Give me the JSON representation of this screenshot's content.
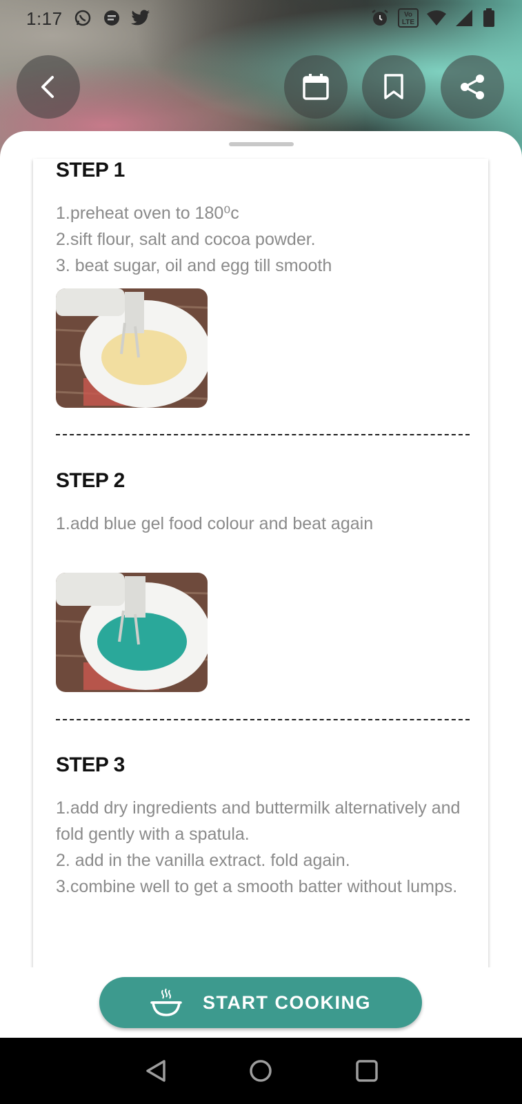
{
  "status_bar": {
    "time": "1:17",
    "left_icons": [
      "whatsapp-icon",
      "message-icon",
      "twitter-icon"
    ],
    "right_icons": [
      "alarm-icon",
      "volte-icon",
      "wifi-icon",
      "signal-icon",
      "battery-icon"
    ],
    "volte_text": "Vo LTE"
  },
  "top_actions": {
    "back": "back-icon",
    "calendar": "calendar-icon",
    "bookmark": "bookmark-icon",
    "share": "share-icon"
  },
  "steps": [
    {
      "title": "STEP 1",
      "text": "1.preheat oven to 180⁰c\n2.sift flour, salt and cocoa powder.\n3. beat sugar, oil and egg till smooth",
      "image": "mixer in bowl with yellow batter"
    },
    {
      "title": "STEP 2",
      "text": "1.add blue gel food colour and beat again",
      "image": "mixer in bowl with teal batter"
    },
    {
      "title": "STEP 3",
      "text": "1.add dry ingredients and buttermilk alternatively and fold gently with a spatula.\n2. add in the vanilla extract. fold again.\n3.combine well to get a smooth batter without lumps."
    }
  ],
  "start_button": {
    "label": "START COOKING",
    "icon": "cooking-pot-icon"
  },
  "colors": {
    "accent": "#3d9a8e",
    "step_text": "#8a8a8a"
  },
  "nav": {
    "back": "nav-back-icon",
    "home": "nav-home-icon",
    "recents": "nav-recents-icon"
  }
}
